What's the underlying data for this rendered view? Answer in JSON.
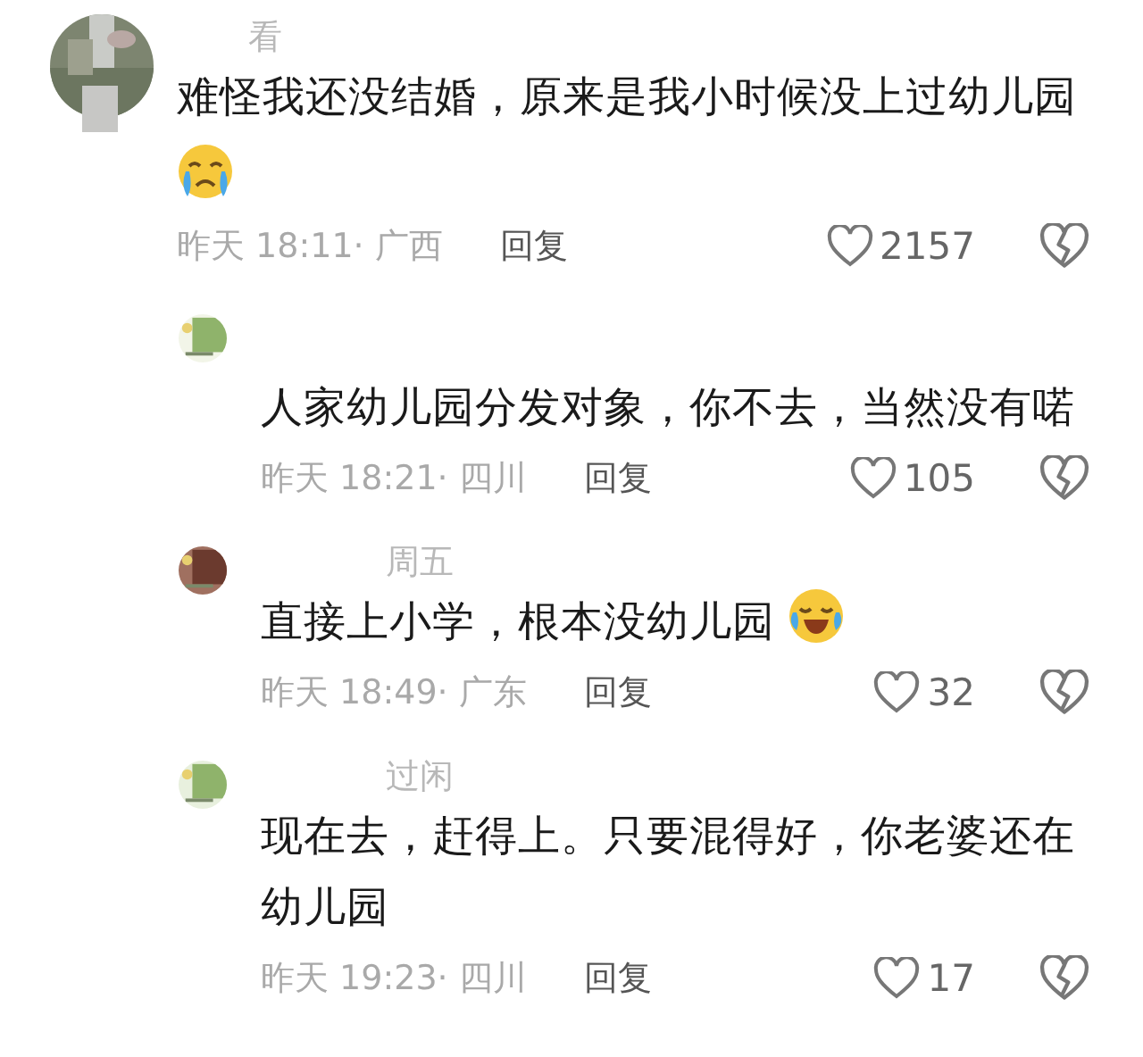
{
  "comments": [
    {
      "kind": "main",
      "author": "看",
      "text": "难怪我还没结婚，原来是我小时候没上过幼儿园",
      "emoji": {
        "kind": "crying"
      },
      "meta": "昨天 18:11· 广西",
      "reply": "回复",
      "likes": "2157"
    },
    {
      "kind": "reply",
      "text": "人家幼儿园分发对象，你不去，当然没有喏",
      "meta": "昨天 18:21· 四川",
      "reply": "回复",
      "likes": "105"
    },
    {
      "kind": "reply",
      "author": "周五",
      "text": "直接上小学，根本没幼儿园",
      "emoji": {
        "kind": "laughing"
      },
      "meta": "昨天 18:49· 广东",
      "reply": "回复",
      "likes": "32"
    },
    {
      "kind": "reply",
      "author": "过闲",
      "text": "现在去，赶得上。只要混得好，你老婆还在幼儿园",
      "meta": "昨天 19:23· 四川",
      "reply": "回复",
      "likes": "17"
    }
  ]
}
